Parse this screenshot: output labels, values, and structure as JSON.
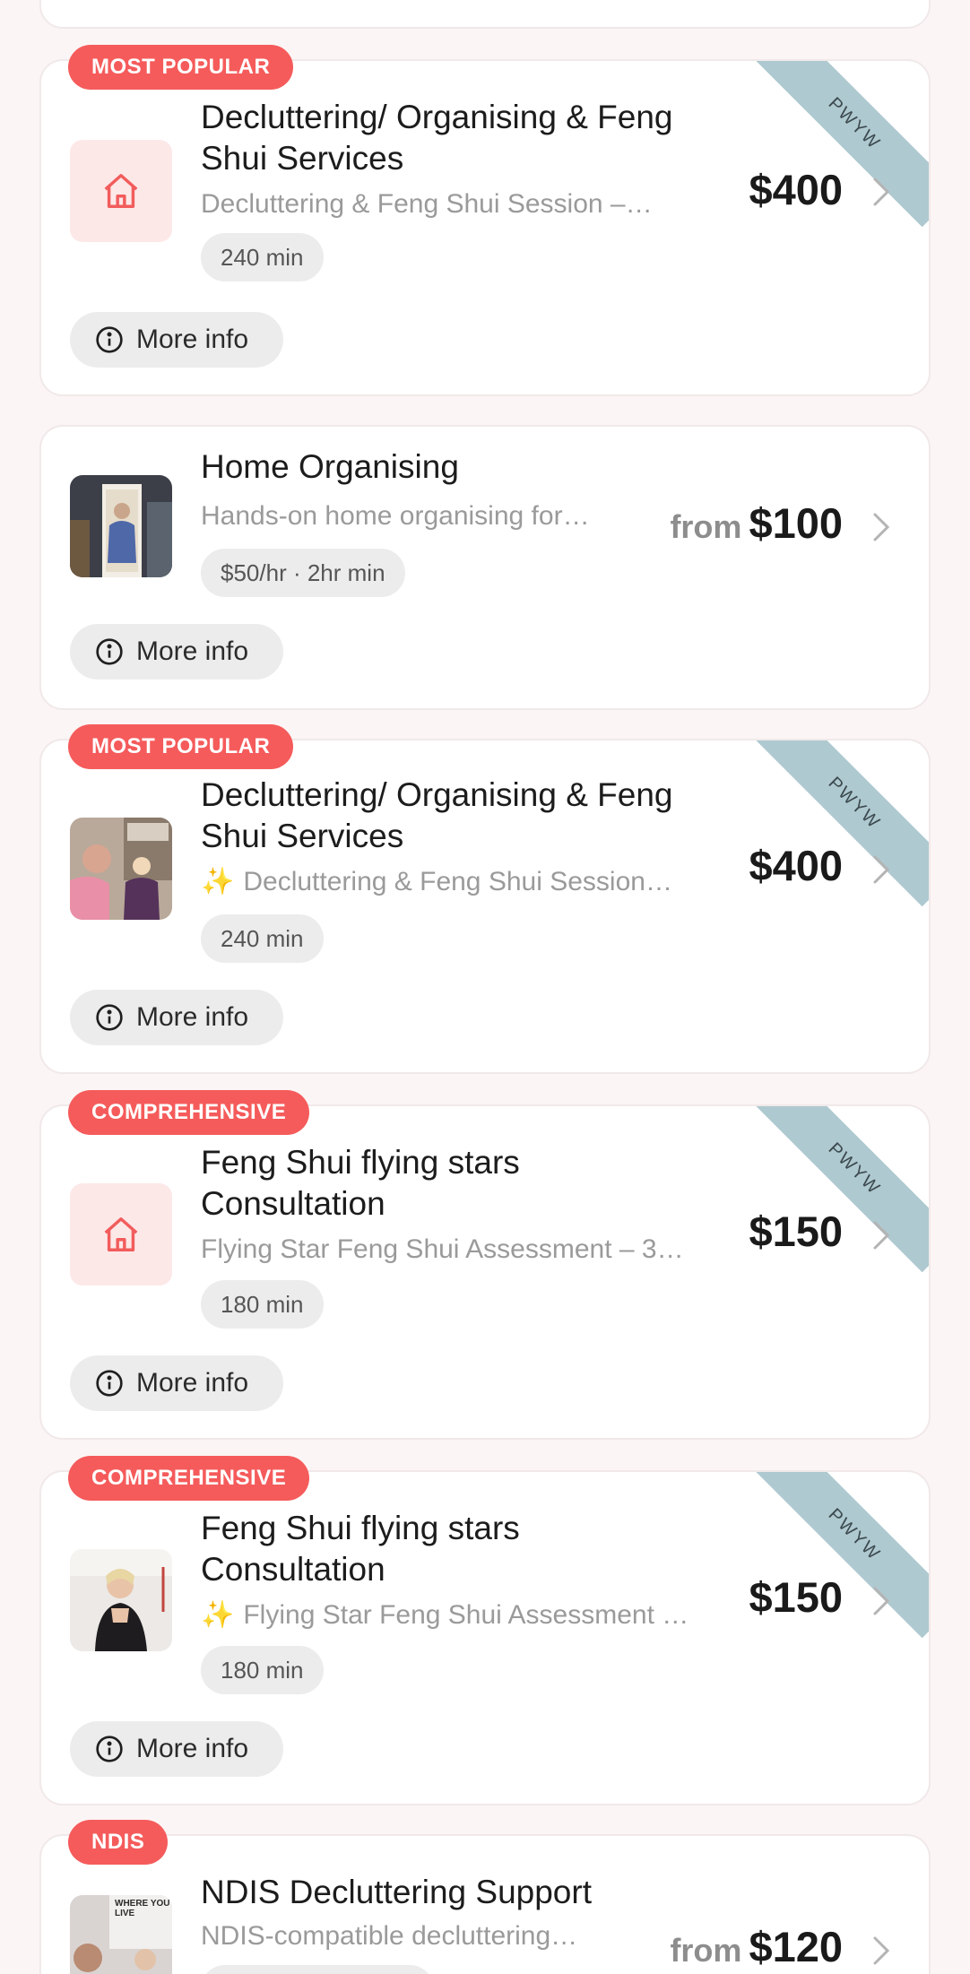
{
  "more_info_label": "More info",
  "ribbon_label": "PWYW",
  "cards": [
    {
      "badge": "MOST POPULAR",
      "title": "Decluttering/ Organising & Feng Shui Services",
      "description": "Decluttering & Feng Shui Session –…",
      "duration": "240 min",
      "price_prefix": "",
      "price": "$400",
      "thumb": "home-icon"
    },
    {
      "badge": "",
      "title": "Home Organising",
      "description": "Hands-on home organising for…",
      "duration": "$50/hr · 2hr min",
      "price_prefix": "from",
      "price": "$100",
      "thumb": "photo"
    },
    {
      "badge": "MOST POPULAR",
      "title": "Decluttering/ Organising & Feng Shui Services",
      "description": "Decluttering & Feng Shui Session…",
      "duration": "240 min",
      "price_prefix": "",
      "price": "$400",
      "thumb": "photo"
    },
    {
      "badge": "COMPREHENSIVE",
      "title": "Feng Shui flying stars Consultation",
      "description": "Flying Star Feng Shui Assessment – 3…",
      "duration": "180 min",
      "price_prefix": "",
      "price": "$150",
      "thumb": "home-icon"
    },
    {
      "badge": "COMPREHENSIVE",
      "title": "Feng Shui flying stars Consultation",
      "description": "Flying Star Feng Shui Assessment …",
      "duration": "180 min",
      "price_prefix": "",
      "price": "$150",
      "thumb": "photo"
    },
    {
      "badge": "NDIS",
      "title": "NDIS Decluttering Support",
      "description": "NDIS-compatible decluttering…",
      "duration": "",
      "price_prefix": "from",
      "price": "$120",
      "thumb": "photo",
      "thumb_text": "WHERE YOU LIVE"
    }
  ],
  "colors": {
    "badge": "#f55b5b",
    "ribbon": "#afc9d0",
    "background": "#fcf5f5",
    "thumb_tint": "#fde8e8"
  }
}
